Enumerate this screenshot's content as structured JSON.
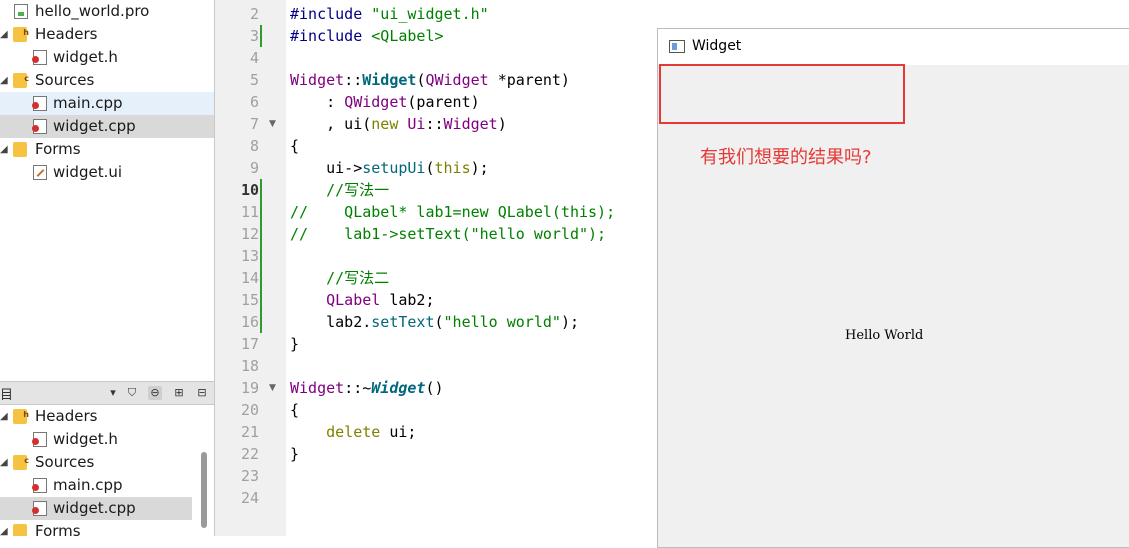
{
  "project_tree": {
    "items": [
      {
        "label": "hello_world.pro"
      },
      {
        "label": "Headers"
      },
      {
        "label": "widget.h"
      },
      {
        "label": "Sources"
      },
      {
        "label": "main.cpp"
      },
      {
        "label": "widget.cpp"
      },
      {
        "label": "Forms"
      },
      {
        "label": "widget.ui"
      }
    ],
    "lower_items": [
      {
        "label": "Headers"
      },
      {
        "label": "widget.h"
      },
      {
        "label": "Sources"
      },
      {
        "label": "main.cpp"
      },
      {
        "label": "widget.cpp"
      },
      {
        "label": "Forms"
      }
    ],
    "panel_label": "目"
  },
  "editor": {
    "line_numbers": [
      "2",
      "3",
      "4",
      "5",
      "6",
      "7",
      "8",
      "9",
      "10",
      "11",
      "12",
      "13",
      "14",
      "15",
      "16",
      "17",
      "18",
      "19",
      "20",
      "21",
      "22",
      "23",
      "24"
    ],
    "lines": [
      [
        "#include ",
        "\"ui_widget.h\""
      ],
      [
        "#include ",
        "<QLabel>"
      ],
      [
        ""
      ],
      [
        "Widget",
        "::",
        "Widget",
        "(",
        "QWidget",
        " *parent)"
      ],
      [
        "    : ",
        "QWidget",
        "(parent)"
      ],
      [
        "    , ui(",
        "new",
        " ",
        "Ui",
        "::",
        "Widget",
        ")"
      ],
      [
        "{"
      ],
      [
        "    ui->",
        "setupUi",
        "(",
        "this",
        ");"
      ],
      [
        "    //写法一"
      ],
      [
        "//    QLabel* lab1=new QLabel(this);"
      ],
      [
        "//    lab1->setText(\"hello world\");"
      ],
      [
        ""
      ],
      [
        "    //写法二"
      ],
      [
        "    ",
        "QLabel",
        " lab2;"
      ],
      [
        "    lab2.",
        "setText",
        "(",
        "\"hello world\"",
        ");"
      ],
      [
        "}"
      ],
      [
        ""
      ],
      [
        "Widget",
        "::~",
        "Widget",
        "()"
      ],
      [
        "{"
      ],
      [
        "    ",
        "delete",
        " ui;"
      ],
      [
        "}"
      ],
      [
        ""
      ],
      [
        ""
      ]
    ]
  },
  "widget_window": {
    "title": "Widget",
    "question": "有我们想要的结果吗?",
    "label_text": "Hello World"
  },
  "colors": {
    "accent_red": "#e53935",
    "keyword": "#808000",
    "class": "#800080",
    "function": "#00677c",
    "string": "#008000"
  }
}
